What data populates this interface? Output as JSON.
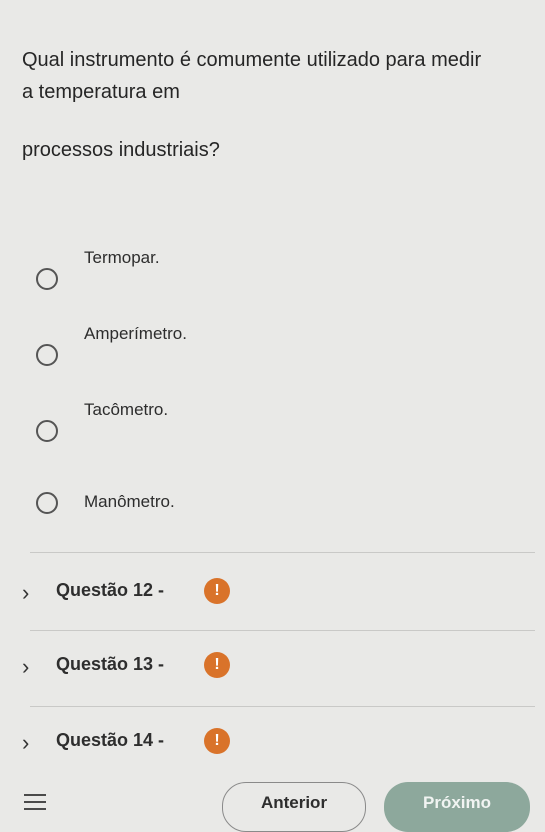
{
  "question": {
    "line1": "Qual instrumento é comumente utilizado para medir",
    "line2": "a temperatura em",
    "line3": "processos industriais?"
  },
  "options": [
    {
      "label": "Termopar."
    },
    {
      "label": "Amperímetro."
    },
    {
      "label": "Tacômetro."
    },
    {
      "label": "Manômetro."
    }
  ],
  "questions_nav": [
    {
      "label": "Questão 12 -",
      "alert": "!"
    },
    {
      "label": "Questão 13 -",
      "alert": "!"
    },
    {
      "label": "Questão 14 -",
      "alert": "!"
    }
  ],
  "footer": {
    "prev_label": "Anterior",
    "next_label": "Próximo"
  },
  "colors": {
    "background": "#e9e9e7",
    "alert": "#d9732a",
    "next_button": "#8da89c"
  }
}
